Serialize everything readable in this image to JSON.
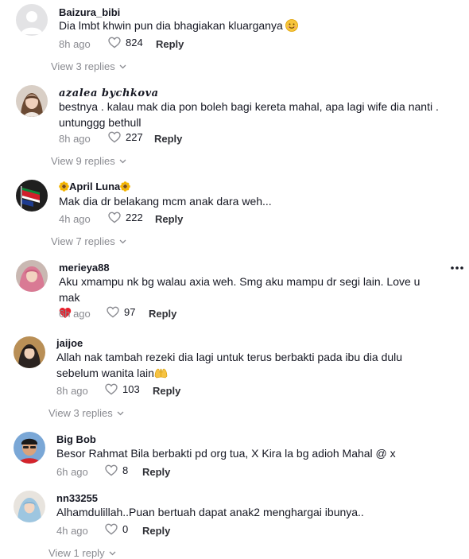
{
  "comments": [
    {
      "username": "Baizura_bibi",
      "text": "Dia lmbt khwin pun dia bhagiakan kluarganya",
      "text_emoji": "smiling-face",
      "time": "8h ago",
      "likes": "824",
      "reply_label": "Reply",
      "view_replies": "View 3 replies"
    },
    {
      "username": "azalea bychkova",
      "text": "bestnya . kalau mak dia pon boleh bagi kereta mahal, apa lagi wife dia nanti . untunggg bethull",
      "time": "8h ago",
      "likes": "227",
      "reply_label": "Reply",
      "view_replies": "View 9 replies"
    },
    {
      "username": "April Luna",
      "username_emoji": "sunflower",
      "text": "Mak dia dr belakang mcm anak dara weh...",
      "time": "4h ago",
      "likes": "222",
      "reply_label": "Reply",
      "view_replies": "View 7 replies"
    },
    {
      "username": "merieya88",
      "text": "Aku xmampu nk bg walau axia weh. Smg aku mampu dr segi lain. Love u mak",
      "text_emoji": "red-heart",
      "time": "6h ago",
      "likes": "97",
      "reply_label": "Reply",
      "more_icon": "more-horizontal-icon"
    },
    {
      "username": "jaijoe",
      "text": "Allah nak tambah rezeki dia lagi untuk terus berbakti pada ibu dia dulu sebelum wanita lain",
      "text_emoji": "palms-up",
      "time": "8h ago",
      "likes": "103",
      "reply_label": "Reply",
      "view_replies": "View 3 replies"
    },
    {
      "username": "Big Bob",
      "text": "Besor Rahmat Bila berbakti pd org tua, X Kira la bg adioh Mahal @ x",
      "time": "6h ago",
      "likes": "8",
      "reply_label": "Reply"
    },
    {
      "username": "nn33255",
      "text": "Alhamdulillah..Puan bertuah dapat anak2 menghargai ibunya..",
      "time": "4h ago",
      "likes": "0",
      "reply_label": "Reply",
      "view_replies": "View 1 reply"
    }
  ],
  "colors": {
    "text": "#161823",
    "muted": "#8a8b91",
    "reply": "#2f3036",
    "heart": "#fe2c55"
  }
}
